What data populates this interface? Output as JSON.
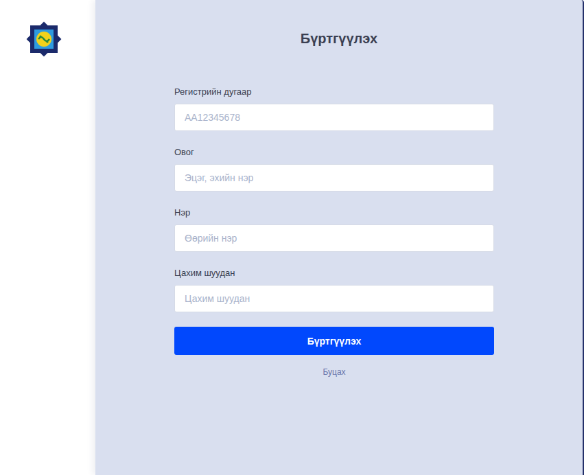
{
  "page": {
    "title": "Бүртгүүлэх"
  },
  "fields": [
    {
      "label": "Регистрийн дугаар",
      "placeholder": "АА12345678"
    },
    {
      "label": "Овог",
      "placeholder": "Эцэг, эхийн нэр"
    },
    {
      "label": "Нэр",
      "placeholder": "Өөрийн нэр"
    },
    {
      "label": "Цахим шуудан",
      "placeholder": "Цахим шуудан"
    }
  ],
  "submit_button": "Бүртгүүлэх",
  "back_link": "Буцах"
}
